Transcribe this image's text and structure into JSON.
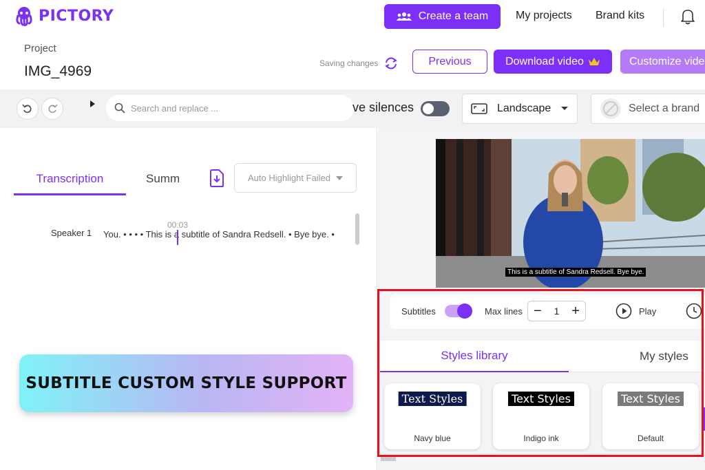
{
  "app": {
    "logo_text": "PICTORY"
  },
  "nav": {
    "create_team": "Create a team",
    "my_projects": "My projects",
    "brand_kits": "Brand kits"
  },
  "project": {
    "label": "Project",
    "name": "IMG_4969",
    "saving": "Saving changes"
  },
  "actions": {
    "previous": "Previous",
    "download": "Download video",
    "customize": "Customize vide"
  },
  "toolbar": {
    "search_placeholder": "Search and replace ...",
    "silences_label": "ve silences",
    "aspect": "Landscape",
    "brand": "Select a brand"
  },
  "transcript_panel": {
    "tab_transcription": "Transcription",
    "tab_summary": "Summ",
    "auto_highlight": "Auto Highlight Failed",
    "speaker": "Speaker 1",
    "timestamp": "00:03",
    "text": "You. • • • • This is a subtitle of Sandra Redsell. • Bye bye. •"
  },
  "promo_banner": "SUBTITLE CUSTOM STYLE SUPPORT",
  "preview": {
    "caption": "This is a subtitle of Sandra Redsell. Bye bye."
  },
  "subtitle_controls": {
    "subtitles_label": "Subtitles",
    "subtitles_on": true,
    "max_lines_label": "Max lines",
    "max_lines_value": "1",
    "play_label": "Play"
  },
  "styles": {
    "tab_library": "Styles library",
    "tab_my": "My styles",
    "cards": [
      {
        "sample": "Text Styles",
        "name": "Navy blue",
        "bg": "#0d1a4a",
        "fg": "#ffffff"
      },
      {
        "sample": "Text Styles",
        "name": "Indigo ink",
        "bg": "#000000",
        "fg": "#ffffff"
      },
      {
        "sample": "Text Styles",
        "name": "Default",
        "bg": "#7a7a7a",
        "fg": "#ffffff"
      }
    ]
  },
  "colors": {
    "accent": "#7b2ff7",
    "highlight_border": "#e8101a"
  }
}
